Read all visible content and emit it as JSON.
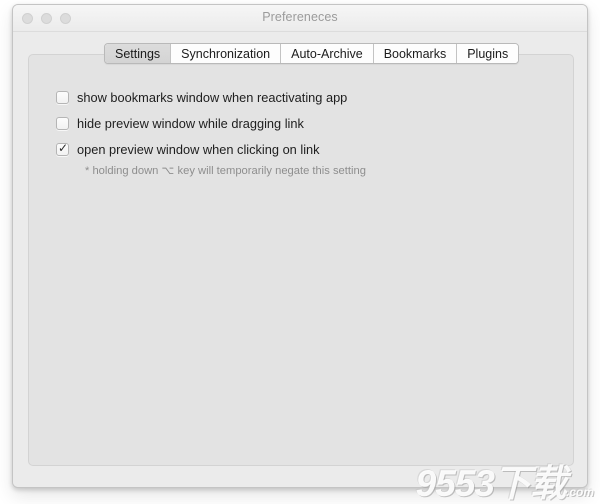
{
  "window": {
    "title": "Prefereneces",
    "traffic_lights": [
      {
        "name": "close",
        "color": "#dcdcdc"
      },
      {
        "name": "minimize",
        "color": "#dcdcdc"
      },
      {
        "name": "zoom",
        "color": "#dcdcdc"
      }
    ]
  },
  "tabs": [
    {
      "label": "Settings",
      "selected": true
    },
    {
      "label": "Synchronization",
      "selected": false
    },
    {
      "label": "Auto-Archive",
      "selected": false
    },
    {
      "label": "Bookmarks",
      "selected": false
    },
    {
      "label": "Plugins",
      "selected": false
    }
  ],
  "options": [
    {
      "label": "show bookmarks window when reactivating app",
      "checked": false
    },
    {
      "label": "hide preview window while dragging link",
      "checked": false
    },
    {
      "label": "open preview window when clicking on link",
      "checked": true
    }
  ],
  "hint": "* holding down ⌥ key will temporarily negate this setting",
  "checkmark_glyph": "✓",
  "watermark": {
    "text": "9553下载",
    "suffix": ".com"
  },
  "colors": {
    "window_background": "#ececec",
    "titlebar": "#f2f2f2",
    "panel": "#e3e3e3",
    "selected_tab": "#d8d8d8",
    "text": "#1e1e1e",
    "hint_text": "#8e8e8e",
    "title_text": "#9b9b9b"
  }
}
